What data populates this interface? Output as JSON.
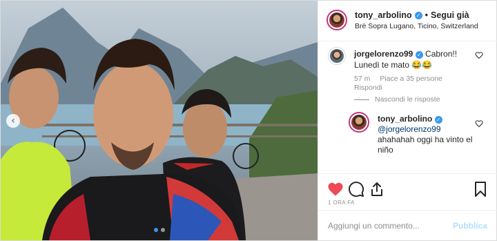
{
  "header": {
    "username": "tony_arbolino",
    "bullet": "•",
    "follow_label": "Segui già",
    "location": "Brè Sopra Lugano, Ticino, Switzerland"
  },
  "comments": [
    {
      "username": "jorgelorenzo99",
      "text": "Cabron!! Lunedì te mato 😂😂",
      "time": "57 m",
      "likes": "Piace a 35 persone",
      "reply_label": "Rispondi",
      "hide_replies_label": "Nascondi le risposte"
    },
    {
      "username": "tony_arbolino",
      "mention": "@jorgelorenzo99",
      "text": "ahahahah oggi ha vinto el niño"
    }
  ],
  "actions": {
    "time_ago": "1 ORA FA"
  },
  "add_comment": {
    "placeholder": "Aggiungi un commento...",
    "publish_label": "Pubblica"
  },
  "carousel": {
    "slide_count": 2,
    "active_index": 0
  },
  "colors": {
    "liked_heart": "#ed4956",
    "verified": "#3897f0",
    "story_ring": "#c13584",
    "publish_disabled": "#b2dffc"
  }
}
